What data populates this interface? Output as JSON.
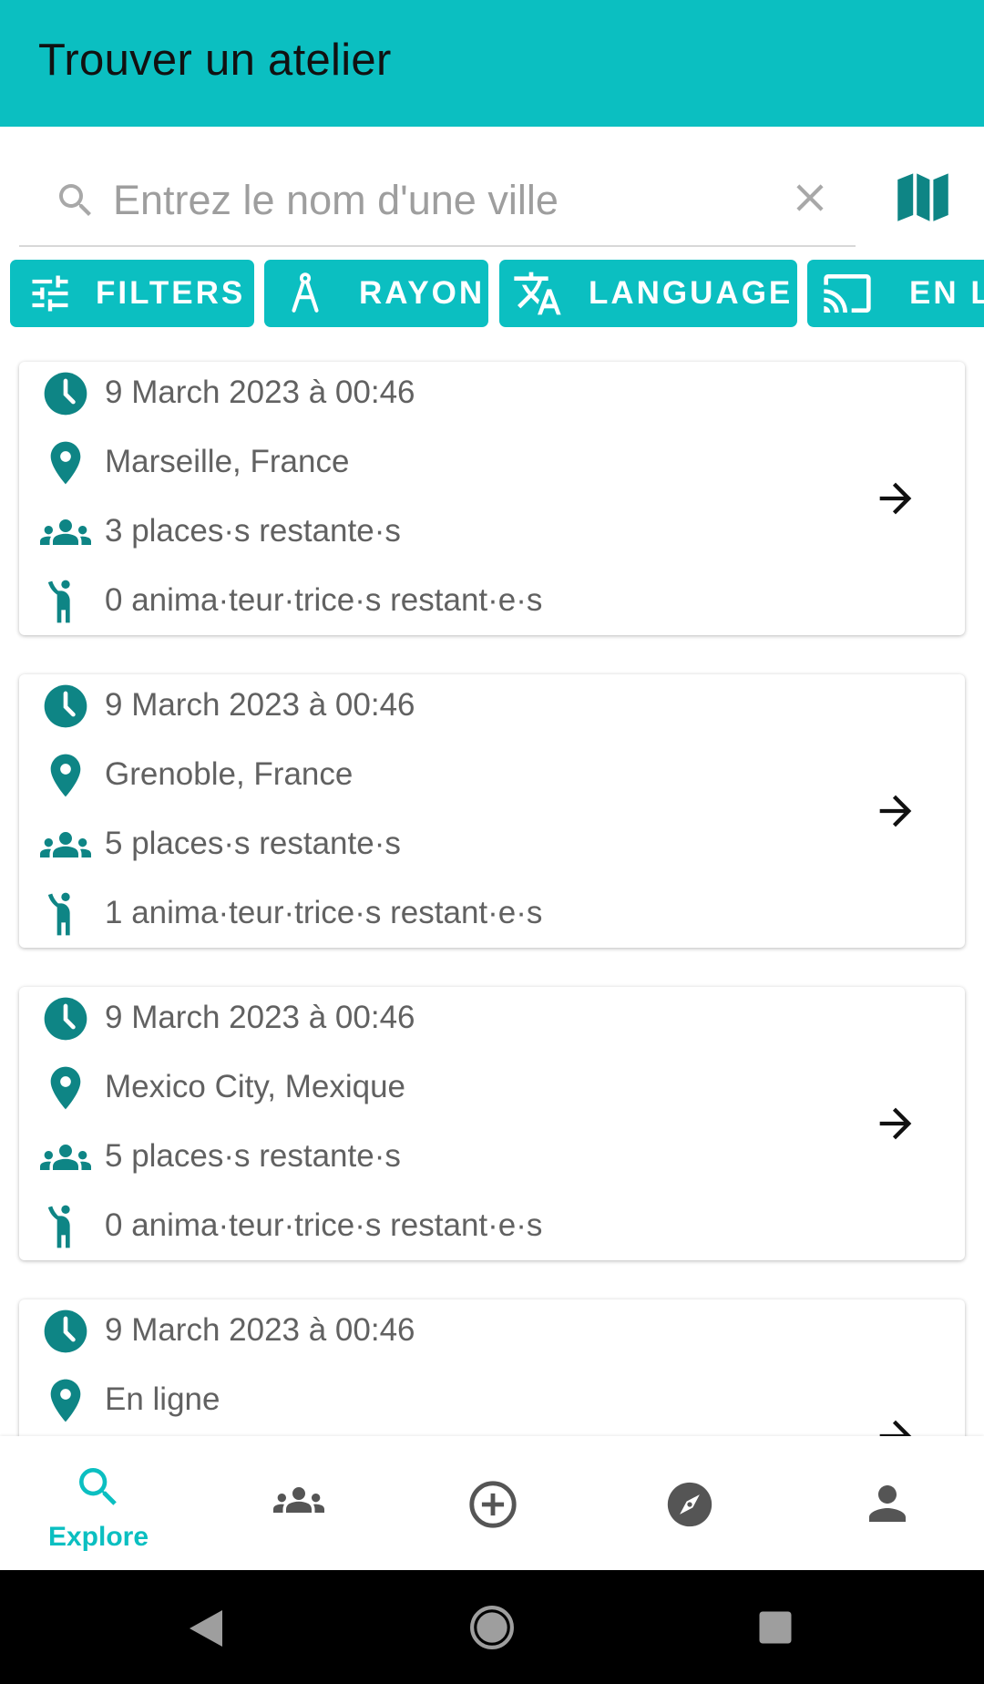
{
  "appbar": {
    "title": "Trouver un atelier"
  },
  "search": {
    "placeholder": "Entrez le nom d'une ville"
  },
  "chips": [
    {
      "label": "FILTERS",
      "icon": "tune-icon"
    },
    {
      "label": "RAYON",
      "icon": "compass-rayon-icon"
    },
    {
      "label": "LANGUAGE",
      "icon": "translate-icon"
    },
    {
      "label": "EN LIGNE",
      "icon": "cast-icon"
    }
  ],
  "workshops": [
    {
      "date": "9 March 2023 à 00:46",
      "location": "Marseille, France",
      "places": "3 places·s restante·s",
      "facilitators": "0 anima·teur·trice·s restant·e·s"
    },
    {
      "date": "9 March 2023 à 00:46",
      "location": "Grenoble, France",
      "places": "5 places·s restante·s",
      "facilitators": "1 anima·teur·trice·s restant·e·s"
    },
    {
      "date": "9 March 2023 à 00:46",
      "location": "Mexico City, Mexique",
      "places": "5 places·s restante·s",
      "facilitators": "0 anima·teur·trice·s restant·e·s"
    },
    {
      "date": "9 March 2023 à 00:46",
      "location": "En ligne",
      "places": "",
      "facilitators": ""
    }
  ],
  "bottom_nav": {
    "active": "explore",
    "items": [
      {
        "id": "explore",
        "label": "Explore",
        "icon": "search-icon"
      },
      {
        "id": "community",
        "label": "",
        "icon": "group-icon"
      },
      {
        "id": "create",
        "label": "",
        "icon": "add-circle-icon"
      },
      {
        "id": "discover",
        "label": "",
        "icon": "compass-icon"
      },
      {
        "id": "profile",
        "label": "",
        "icon": "person-icon"
      }
    ]
  },
  "colors": {
    "primary": "#0bbfc1",
    "icon_teal": "#0e8585",
    "text_secondary": "#616161"
  }
}
